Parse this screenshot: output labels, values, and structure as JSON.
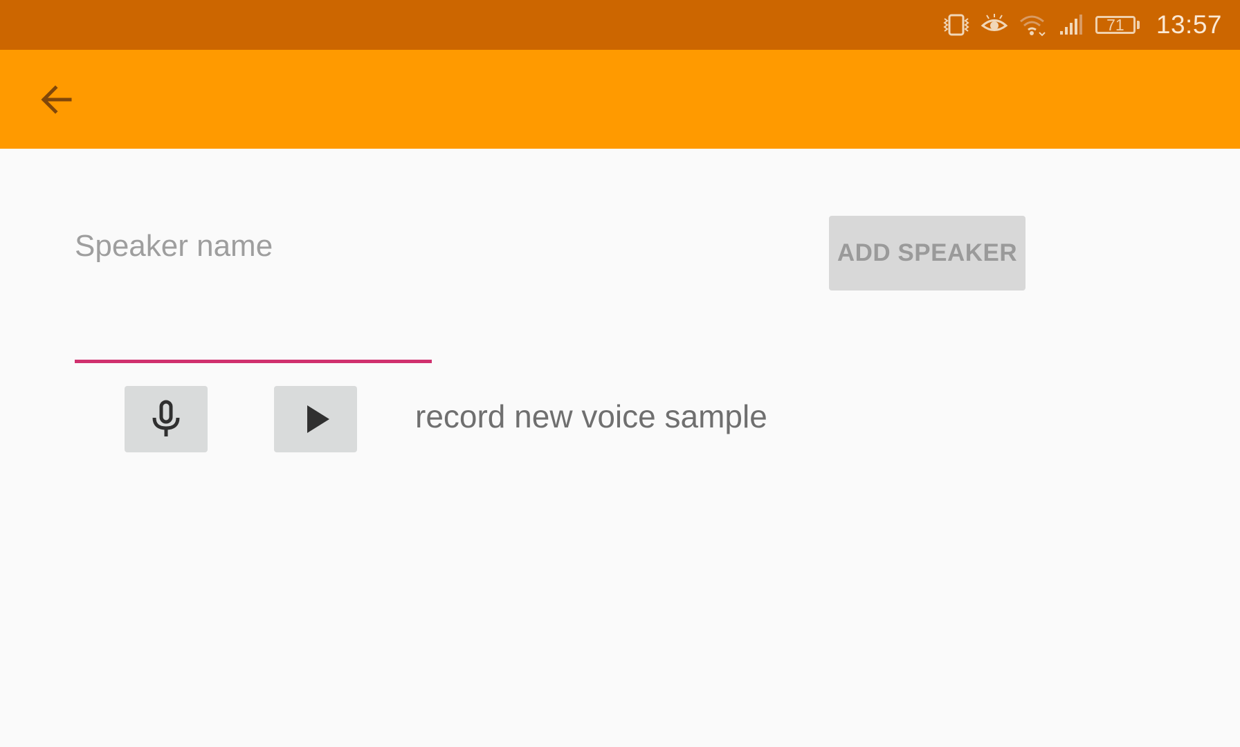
{
  "status_bar": {
    "time": "13:57",
    "battery_level": "71",
    "icons": [
      "vibrate-icon",
      "eye-icon",
      "wifi-icon",
      "signal-icon",
      "battery-icon"
    ]
  },
  "app_bar": {
    "back_icon": "arrow-left-icon"
  },
  "form": {
    "speaker_name_placeholder": "Speaker name",
    "speaker_name_value": "",
    "add_speaker_label": "ADD SPEAKER",
    "record_icon": "microphone-icon",
    "play_icon": "play-icon",
    "voice_sample_label": "record new voice sample"
  },
  "colors": {
    "status_bar": "#cc6600",
    "app_bar": "#ff9a00",
    "input_underline": "#d0306e",
    "button_background": "#d9dbdb"
  }
}
